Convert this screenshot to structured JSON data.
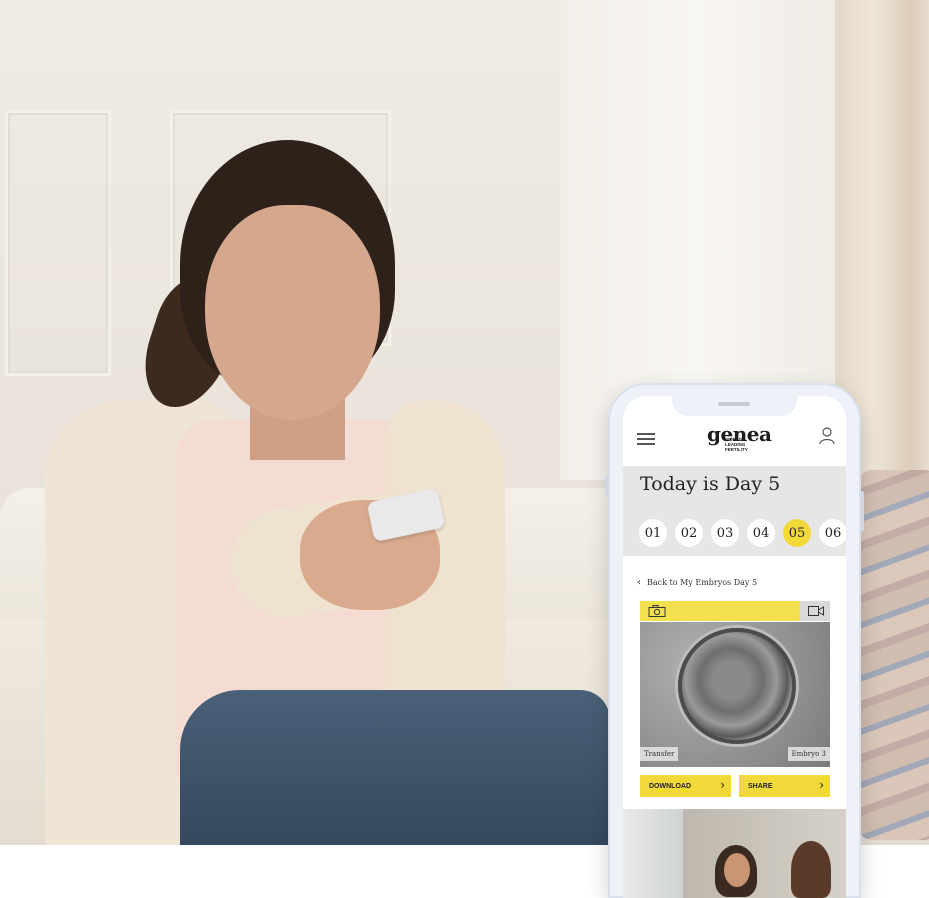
{
  "app": {
    "logo": {
      "wordmark": "genea",
      "tagline": "WORLD LEADING FERTILITY"
    },
    "day_title": "Today is Day 5",
    "days": [
      "01",
      "02",
      "03",
      "04",
      "05",
      "06"
    ],
    "active_day": "05",
    "back_link": "Back to My Embryos Day 5",
    "media_tabs": {
      "photo_icon": "camera-icon",
      "video_icon": "video-icon",
      "active": "photo"
    },
    "embryo_labels": {
      "left": "Transfer",
      "right": "Embryo 3"
    },
    "actions": {
      "download": "DOWNLOAD",
      "share": "SHARE"
    }
  },
  "colors": {
    "accent_yellow": "#f2d93a",
    "band_grey": "#e6e6e6",
    "phone_frame": "#eef2f8"
  }
}
